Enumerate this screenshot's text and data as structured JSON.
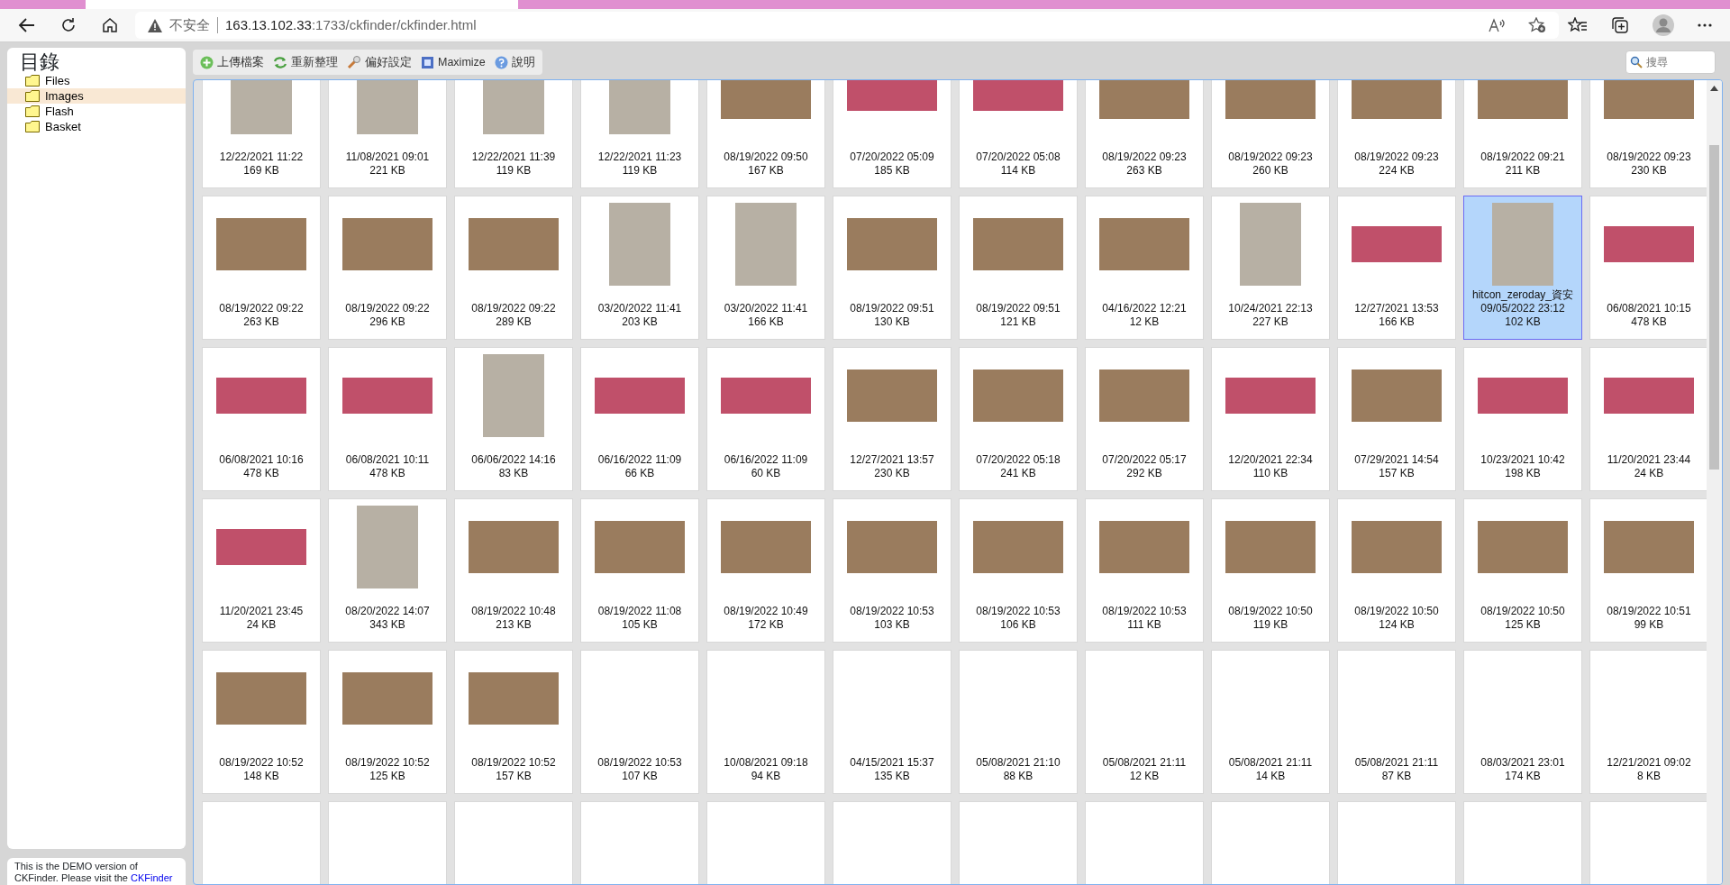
{
  "browser": {
    "security": "不安全",
    "url_host": "163.13.102.33",
    "url_rest": ":1733/ckfinder/ckfinder.html"
  },
  "sidebar": {
    "title": "目錄",
    "folders": [
      {
        "label": "Files",
        "selected": false
      },
      {
        "label": "Images",
        "selected": true
      },
      {
        "label": "Flash",
        "selected": false
      },
      {
        "label": "Basket",
        "selected": false
      }
    ]
  },
  "toolbar": {
    "buttons": [
      {
        "label": "上傳檔案",
        "kind": "upload"
      },
      {
        "label": "重新整理",
        "kind": "refresh"
      },
      {
        "label": "偏好設定",
        "kind": "settings"
      },
      {
        "label": "Maximize",
        "kind": "maximize"
      },
      {
        "label": "說明",
        "kind": "help"
      }
    ],
    "search": {
      "placeholder": "搜尋"
    }
  },
  "files": [
    {
      "kind": "poster",
      "date": "12/22/2021 11:22",
      "size": "169 KB",
      "selected": false
    },
    {
      "kind": "poster",
      "date": "11/08/2021 09:01",
      "size": "221 KB",
      "selected": false
    },
    {
      "kind": "poster",
      "date": "12/22/2021 11:39",
      "size": "119 KB",
      "selected": false
    },
    {
      "kind": "poster",
      "date": "12/22/2021 11:23",
      "size": "119 KB",
      "selected": false
    },
    {
      "kind": "photo",
      "date": "08/19/2022 09:50",
      "size": "167 KB",
      "selected": false
    },
    {
      "kind": "banner",
      "date": "07/20/2022 05:09",
      "size": "185 KB",
      "selected": false
    },
    {
      "kind": "banner",
      "date": "07/20/2022 05:08",
      "size": "114 KB",
      "selected": false
    },
    {
      "kind": "photo",
      "date": "08/19/2022 09:23",
      "size": "263 KB",
      "selected": false
    },
    {
      "kind": "photo",
      "date": "08/19/2022 09:23",
      "size": "260 KB",
      "selected": false
    },
    {
      "kind": "photo",
      "date": "08/19/2022 09:23",
      "size": "224 KB",
      "selected": false
    },
    {
      "kind": "photo",
      "date": "08/19/2022 09:21",
      "size": "211 KB",
      "selected": false
    },
    {
      "kind": "photo",
      "date": "08/19/2022 09:23",
      "size": "230 KB",
      "selected": false
    },
    {
      "kind": "photo",
      "date": "08/19/2022 09:22",
      "size": "263 KB",
      "selected": false
    },
    {
      "kind": "photo",
      "date": "08/19/2022 09:22",
      "size": "296 KB",
      "selected": false
    },
    {
      "kind": "photo",
      "date": "08/19/2022 09:22",
      "size": "289 KB",
      "selected": false
    },
    {
      "kind": "poster",
      "date": "03/20/2022 11:41",
      "size": "203 KB",
      "selected": false
    },
    {
      "kind": "poster",
      "date": "03/20/2022 11:41",
      "size": "166 KB",
      "selected": false
    },
    {
      "kind": "photo",
      "date": "08/19/2022 09:51",
      "size": "130 KB",
      "selected": false
    },
    {
      "kind": "photo",
      "date": "08/19/2022 09:51",
      "size": "121 KB",
      "selected": false
    },
    {
      "kind": "photo",
      "date": "04/16/2022 12:21",
      "size": "12 KB",
      "selected": false
    },
    {
      "kind": "poster",
      "date": "10/24/2021 22:13",
      "size": "227 KB",
      "selected": false
    },
    {
      "kind": "banner",
      "date": "12/27/2021 13:53",
      "size": "166 KB",
      "selected": false
    },
    {
      "kind": "poster",
      "name": "hitcon_zeroday_資安",
      "date": "09/05/2022 23:12",
      "size": "102 KB",
      "selected": true
    },
    {
      "kind": "banner",
      "date": "06/08/2021 10:15",
      "size": "478 KB",
      "selected": false
    },
    {
      "kind": "banner",
      "date": "06/08/2021 10:16",
      "size": "478 KB",
      "selected": false
    },
    {
      "kind": "banner",
      "date": "06/08/2021 10:11",
      "size": "478 KB",
      "selected": false
    },
    {
      "kind": "poster",
      "date": "06/06/2022 14:16",
      "size": "83 KB",
      "selected": false
    },
    {
      "kind": "banner",
      "date": "06/16/2022 11:09",
      "size": "66 KB",
      "selected": false
    },
    {
      "kind": "banner",
      "date": "06/16/2022 11:09",
      "size": "60 KB",
      "selected": false
    },
    {
      "kind": "photo",
      "date": "12/27/2021 13:57",
      "size": "230 KB",
      "selected": false
    },
    {
      "kind": "photo",
      "date": "07/20/2022 05:18",
      "size": "241 KB",
      "selected": false
    },
    {
      "kind": "photo",
      "date": "07/20/2022 05:17",
      "size": "292 KB",
      "selected": false
    },
    {
      "kind": "banner",
      "date": "12/20/2021 22:34",
      "size": "110 KB",
      "selected": false
    },
    {
      "kind": "photo",
      "date": "07/29/2021 14:54",
      "size": "157 KB",
      "selected": false
    },
    {
      "kind": "banner",
      "date": "10/23/2021 10:42",
      "size": "198 KB",
      "selected": false
    },
    {
      "kind": "banner",
      "date": "11/20/2021 23:44",
      "size": "24 KB",
      "selected": false
    },
    {
      "kind": "banner",
      "date": "11/20/2021 23:45",
      "size": "24 KB",
      "selected": false
    },
    {
      "kind": "poster",
      "date": "08/20/2022 14:07",
      "size": "343 KB",
      "selected": false
    },
    {
      "kind": "photo",
      "date": "08/19/2022 10:48",
      "size": "213 KB",
      "selected": false
    },
    {
      "kind": "photo",
      "date": "08/19/2022 11:08",
      "size": "105 KB",
      "selected": false
    },
    {
      "kind": "photo",
      "date": "08/19/2022 10:49",
      "size": "172 KB",
      "selected": false
    },
    {
      "kind": "photo",
      "date": "08/19/2022 10:53",
      "size": "103 KB",
      "selected": false
    },
    {
      "kind": "photo",
      "date": "08/19/2022 10:53",
      "size": "106 KB",
      "selected": false
    },
    {
      "kind": "photo",
      "date": "08/19/2022 10:53",
      "size": "111 KB",
      "selected": false
    },
    {
      "kind": "photo",
      "date": "08/19/2022 10:50",
      "size": "119 KB",
      "selected": false
    },
    {
      "kind": "photo",
      "date": "08/19/2022 10:50",
      "size": "124 KB",
      "selected": false
    },
    {
      "kind": "photo",
      "date": "08/19/2022 10:50",
      "size": "125 KB",
      "selected": false
    },
    {
      "kind": "photo",
      "date": "08/19/2022 10:51",
      "size": "99 KB",
      "selected": false
    },
    {
      "kind": "photo",
      "date": "08/19/2022 10:52",
      "size": "148 KB",
      "selected": false
    },
    {
      "kind": "photo",
      "date": "08/19/2022 10:52",
      "size": "125 KB",
      "selected": false
    },
    {
      "kind": "photo",
      "date": "08/19/2022 10:52",
      "size": "157 KB",
      "selected": false
    },
    {
      "kind": "blank",
      "date": "08/19/2022 10:53",
      "size": "107 KB",
      "selected": false
    },
    {
      "kind": "blank",
      "date": "10/08/2021 09:18",
      "size": "94 KB",
      "selected": false
    },
    {
      "kind": "blank",
      "date": "04/15/2021 15:37",
      "size": "135 KB",
      "selected": false
    },
    {
      "kind": "blank",
      "date": "05/08/2021 21:10",
      "size": "88 KB",
      "selected": false
    },
    {
      "kind": "blank",
      "date": "05/08/2021 21:11",
      "size": "12 KB",
      "selected": false
    },
    {
      "kind": "blank",
      "date": "05/08/2021 21:11",
      "size": "14 KB",
      "selected": false
    },
    {
      "kind": "blank",
      "date": "05/08/2021 21:11",
      "size": "87 KB",
      "selected": false
    },
    {
      "kind": "blank",
      "date": "08/03/2021 23:01",
      "size": "174 KB",
      "selected": false
    },
    {
      "kind": "blank",
      "date": "12/21/2021 09:02",
      "size": "8 KB",
      "selected": false
    },
    {
      "kind": "blank",
      "selected": false
    },
    {
      "kind": "blank",
      "selected": false
    },
    {
      "kind": "blank",
      "selected": false
    },
    {
      "kind": "blank",
      "selected": false
    },
    {
      "kind": "blank",
      "selected": false
    },
    {
      "kind": "blank",
      "selected": false
    },
    {
      "kind": "blank",
      "selected": false
    },
    {
      "kind": "blank",
      "selected": false
    },
    {
      "kind": "blank",
      "selected": false
    },
    {
      "kind": "blank",
      "selected": false
    },
    {
      "kind": "blank",
      "selected": false
    },
    {
      "kind": "blank",
      "selected": false
    }
  ],
  "notice": {
    "text": "This is the DEMO version of CKFinder. Please visit the",
    "link": "CKFinder"
  }
}
